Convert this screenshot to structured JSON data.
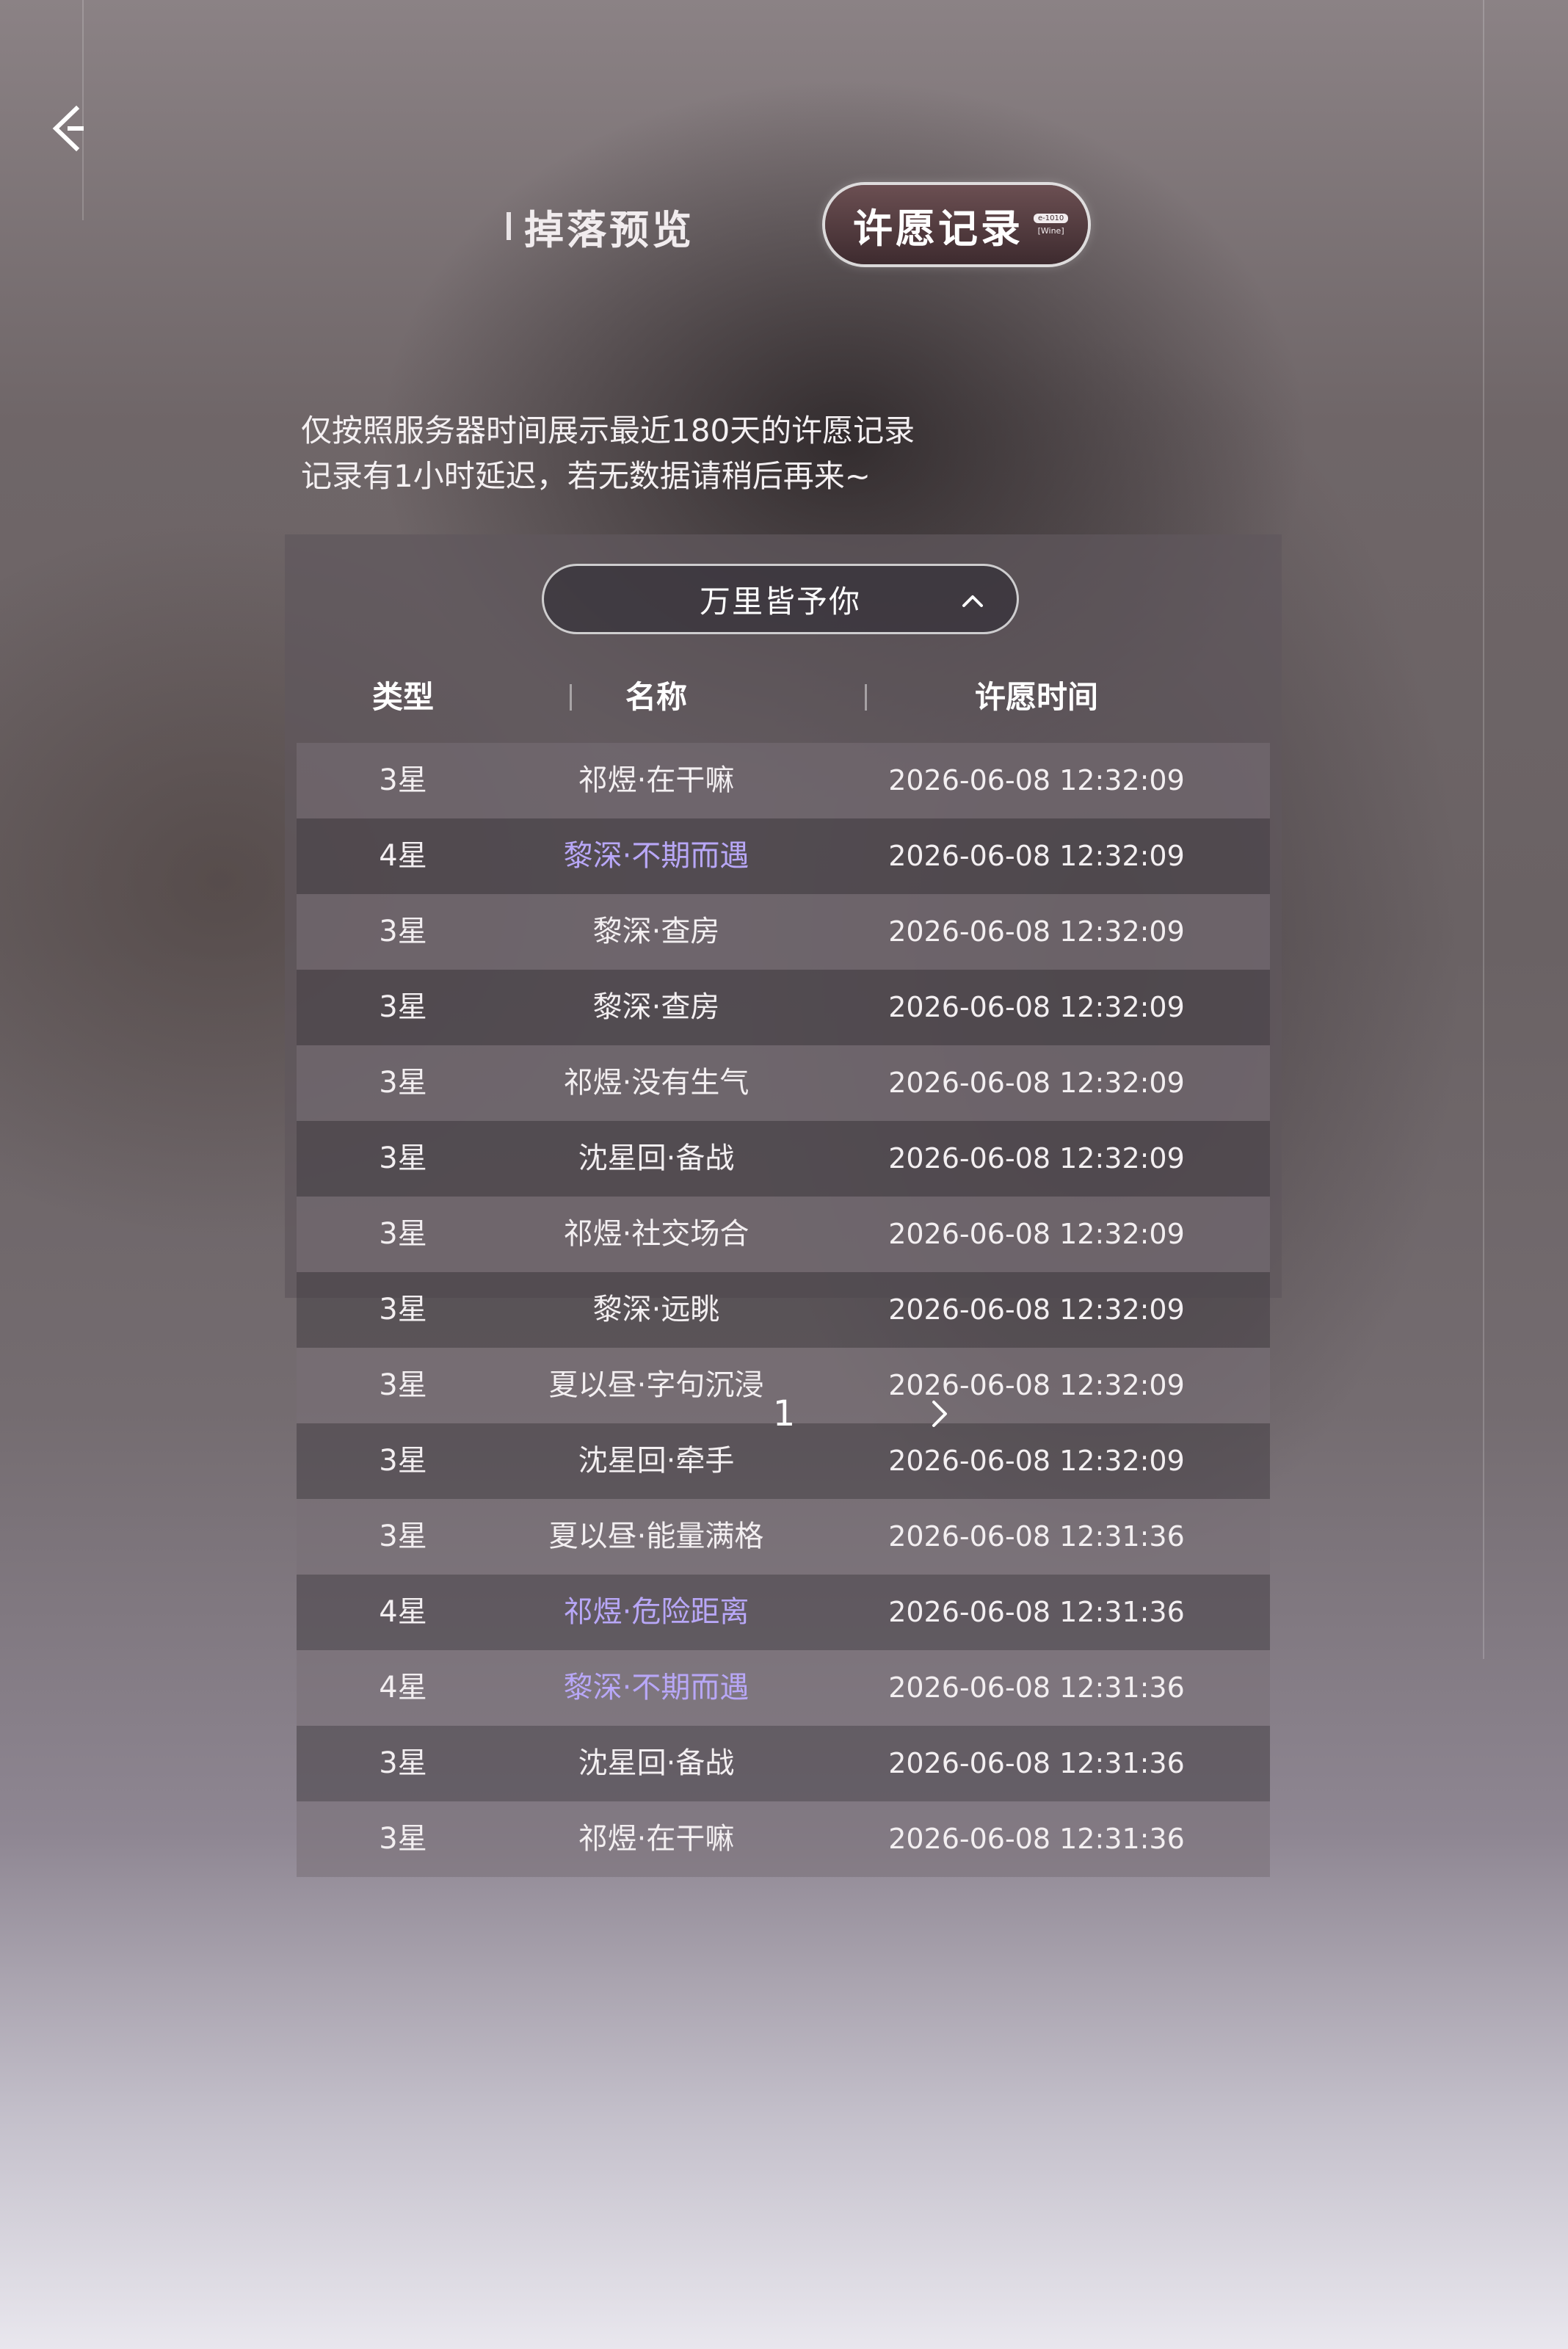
{
  "header": {
    "tabs": [
      {
        "label": "掉落预览",
        "active": false
      },
      {
        "label": "许愿记录",
        "active": true,
        "tag_top": "e-1010",
        "tag_bottom": "[Wine]"
      }
    ]
  },
  "notice": {
    "line1": "仅按照服务器时间展示最近180天的许愿记录",
    "line2": "记录有1小时延迟，若无数据请稍后再来~"
  },
  "pool_select": {
    "selected": "万里皆予你"
  },
  "table": {
    "headers": [
      "类型",
      "名称",
      "许愿时间"
    ],
    "rows": [
      {
        "type": "3星",
        "name": "祁煜·在干嘛",
        "time": "2026-06-08 12:32:09",
        "rare": false
      },
      {
        "type": "4星",
        "name": "黎深·不期而遇",
        "time": "2026-06-08 12:32:09",
        "rare": true
      },
      {
        "type": "3星",
        "name": "黎深·查房",
        "time": "2026-06-08 12:32:09",
        "rare": false
      },
      {
        "type": "3星",
        "name": "黎深·查房",
        "time": "2026-06-08 12:32:09",
        "rare": false
      },
      {
        "type": "3星",
        "name": "祁煜·没有生气",
        "time": "2026-06-08 12:32:09",
        "rare": false
      },
      {
        "type": "3星",
        "name": "沈星回·备战",
        "time": "2026-06-08 12:32:09",
        "rare": false
      },
      {
        "type": "3星",
        "name": "祁煜·社交场合",
        "time": "2026-06-08 12:32:09",
        "rare": false
      },
      {
        "type": "3星",
        "name": "黎深·远眺",
        "time": "2026-06-08 12:32:09",
        "rare": false
      },
      {
        "type": "3星",
        "name": "夏以昼·字句沉浸",
        "time": "2026-06-08 12:32:09",
        "rare": false
      },
      {
        "type": "3星",
        "name": "沈星回·牵手",
        "time": "2026-06-08 12:32:09",
        "rare": false
      },
      {
        "type": "3星",
        "name": "夏以昼·能量满格",
        "time": "2026-06-08 12:31:36",
        "rare": false
      },
      {
        "type": "4星",
        "name": "祁煜·危险距离",
        "time": "2026-06-08 12:31:36",
        "rare": true
      },
      {
        "type": "4星",
        "name": "黎深·不期而遇",
        "time": "2026-06-08 12:31:36",
        "rare": true
      },
      {
        "type": "3星",
        "name": "沈星回·备战",
        "time": "2026-06-08 12:31:36",
        "rare": false
      },
      {
        "type": "3星",
        "name": "祁煜·在干嘛",
        "time": "2026-06-08 12:31:36",
        "rare": false
      }
    ]
  },
  "pagination": {
    "current_page": "1"
  },
  "icons": {
    "back": "back-arrow-icon",
    "dropdown": "chevron-up-icon",
    "next": "chevron-right-icon"
  },
  "colors": {
    "rare_text": "#b8a7f7",
    "active_tab": "#4a3438"
  }
}
